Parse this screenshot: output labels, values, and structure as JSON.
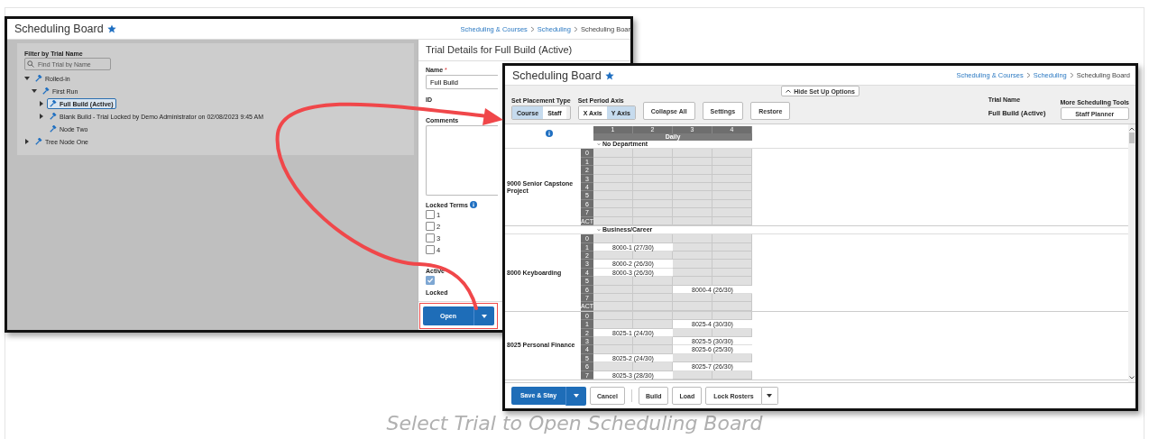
{
  "left_window": {
    "title": "Scheduling Board",
    "breadcrumbs": [
      "Scheduling & Courses",
      "Scheduling",
      "Scheduling Boar"
    ],
    "filter": {
      "label": "Filter by Trial Name",
      "placeholder": "Find Trial by Name"
    },
    "tree": [
      {
        "label": "Rolled-in",
        "kind": "branch",
        "expanded": true,
        "selected": false,
        "children": [
          {
            "label": "First Run",
            "kind": "branch",
            "expanded": true,
            "selected": false,
            "children": [
              {
                "label": "Full Build (Active)",
                "kind": "branch",
                "expanded": false,
                "selected": true
              },
              {
                "label": "Blank Build - Trial Locked by Demo Administrator on 02/08/2023 9:45 AM",
                "kind": "branch",
                "expanded": false,
                "selected": false
              },
              {
                "label": "Node Two",
                "kind": "leaf",
                "selected": false
              }
            ]
          }
        ]
      },
      {
        "label": "Tree Node One",
        "kind": "branch",
        "expanded": false,
        "selected": false
      }
    ],
    "details": {
      "title": "Trial Details for Full Build (Active)",
      "name_label": "Name",
      "required_mark": "*",
      "name_value": "Full Build",
      "id_label": "ID",
      "comments_label": "Comments",
      "locked_terms_label": "Locked Terms",
      "locked_terms": [
        {
          "label": "1",
          "checked": false
        },
        {
          "label": "2",
          "checked": false
        },
        {
          "label": "3",
          "checked": false
        },
        {
          "label": "4",
          "checked": false
        }
      ],
      "active_label": "Active",
      "active_checked": true,
      "locked_label": "Locked",
      "open_button": "Open"
    }
  },
  "right_window": {
    "title": "Scheduling Board",
    "breadcrumbs": [
      "Scheduling & Courses",
      "Scheduling",
      "Scheduling Board"
    ],
    "hide_setup_button": "Hide Set Up Options",
    "placement": {
      "label": "Set Placement Type",
      "options": [
        {
          "label": "Course",
          "selected": true
        },
        {
          "label": "Staff",
          "selected": false
        }
      ]
    },
    "axis": {
      "label": "Set Period Axis",
      "options": [
        {
          "label": "X Axis",
          "selected": false
        },
        {
          "label": "Y Axis",
          "selected": true
        }
      ]
    },
    "tool_buttons": [
      "Collapse All",
      "Settings",
      "Restore"
    ],
    "trial_name": {
      "label": "Trial Name",
      "value": "Full Build (Active)"
    },
    "more_tools": {
      "label": "More Scheduling Tools",
      "button": "Staff Planner"
    },
    "grid": {
      "periods": [
        "1",
        "2",
        "3",
        "4"
      ],
      "term": "Daily",
      "departments": [
        {
          "name": "No Department",
          "courses": [
            {
              "name": "9000 Senior Capstone Project",
              "rows": [
                {
                  "period": "0",
                  "sections": []
                },
                {
                  "period": "1",
                  "sections": []
                },
                {
                  "period": "2",
                  "sections": []
                },
                {
                  "period": "3",
                  "sections": []
                },
                {
                  "period": "4",
                  "sections": []
                },
                {
                  "period": "5",
                  "sections": []
                },
                {
                  "period": "6",
                  "sections": []
                },
                {
                  "period": "7",
                  "sections": []
                },
                {
                  "period": "ACT",
                  "sections": []
                }
              ]
            }
          ]
        },
        {
          "name": "Business/Career",
          "courses": [
            {
              "name": "8000 Keyboarding",
              "rows": [
                {
                  "period": "0",
                  "sections": []
                },
                {
                  "period": "1",
                  "sections": [
                    {
                      "text": "8000-1 (27/30)",
                      "kind": "left"
                    }
                  ]
                },
                {
                  "period": "2",
                  "sections": []
                },
                {
                  "period": "3",
                  "sections": [
                    {
                      "text": "8000-2 (26/30)",
                      "kind": "left"
                    }
                  ]
                },
                {
                  "period": "4",
                  "sections": [
                    {
                      "text": "8000-3 (26/30)",
                      "kind": "left"
                    }
                  ]
                },
                {
                  "period": "5",
                  "sections": []
                },
                {
                  "period": "6",
                  "sections": [
                    {
                      "text": "8000-4 (26/30)",
                      "kind": "right"
                    }
                  ]
                },
                {
                  "period": "7",
                  "sections": []
                },
                {
                  "period": "ACT",
                  "sections": []
                }
              ]
            },
            {
              "name": "8025 Personal Finance",
              "rows": [
                {
                  "period": "0",
                  "sections": []
                },
                {
                  "period": "1",
                  "sections": [
                    {
                      "text": "8025-4 (30/30)",
                      "kind": "right"
                    }
                  ]
                },
                {
                  "period": "2",
                  "sections": [
                    {
                      "text": "8025-1 (24/30)",
                      "kind": "left"
                    }
                  ]
                },
                {
                  "period": "3",
                  "sections": [
                    {
                      "text": "8025-5 (30/30)",
                      "kind": "right"
                    }
                  ]
                },
                {
                  "period": "4",
                  "sections": [
                    {
                      "text": "8025-6 (25/30)",
                      "kind": "right"
                    }
                  ]
                },
                {
                  "period": "5",
                  "sections": [
                    {
                      "text": "8025-2 (24/30)",
                      "kind": "left"
                    }
                  ]
                },
                {
                  "period": "6",
                  "sections": [
                    {
                      "text": "8025-7 (26/30)",
                      "kind": "right"
                    }
                  ]
                },
                {
                  "period": "7",
                  "sections": [
                    {
                      "text": "8025-3 (28/30)",
                      "kind": "left"
                    }
                  ]
                }
              ]
            }
          ]
        }
      ]
    },
    "footer": {
      "save_button": "Save & Stay",
      "cancel_button": "Cancel",
      "buttons": [
        "Build",
        "Load"
      ],
      "lock_rosters_button": "Lock Rosters"
    }
  },
  "caption": "Select Trial to Open Scheduling Board"
}
